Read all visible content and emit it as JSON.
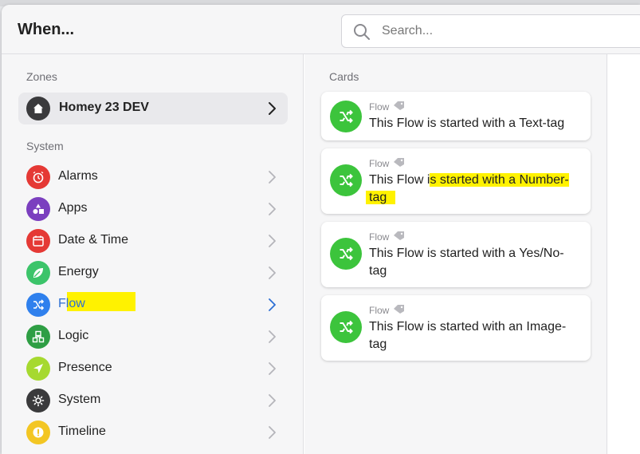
{
  "dialog": {
    "title": "When...",
    "search_placeholder": "Search..."
  },
  "zones": {
    "label": "Zones",
    "item": {
      "label": "Homey 23 DEV",
      "icon": "home-icon"
    }
  },
  "system": {
    "label": "System",
    "items": [
      {
        "label": "Alarms",
        "icon": "alarm-clock-icon",
        "color": "#e53935"
      },
      {
        "label": "Apps",
        "icon": "apps-icon",
        "color": "#7b3fbf"
      },
      {
        "label": "Date & Time",
        "icon": "calendar-icon",
        "color": "#e53935"
      },
      {
        "label": "Energy",
        "icon": "leaf-icon",
        "color": "#3cc46a"
      },
      {
        "label": "Flow",
        "icon": "shuffle-icon",
        "color": "#2f80ed",
        "selected": true
      },
      {
        "label": "Logic",
        "icon": "logic-icon",
        "color": "#2e9e44"
      },
      {
        "label": "Presence",
        "icon": "location-arrow-icon",
        "color": "#a6d930"
      },
      {
        "label": "System",
        "icon": "gear-icon",
        "color": "#3a3a3c"
      },
      {
        "label": "Timeline",
        "icon": "exclamation-icon",
        "color": "#f3c623"
      }
    ]
  },
  "cards": {
    "label": "Cards",
    "items": [
      {
        "app": "Flow",
        "title_line1": "This Flow is started with a Text-tag",
        "title_line2": ""
      },
      {
        "app": "Flow",
        "title_pre": "This Flow i",
        "title_hl1": "s started with a Number-",
        "title_hl2": "tag"
      },
      {
        "app": "Flow",
        "title_line1": "This Flow is started with a Yes/No-",
        "title_line2": "tag"
      },
      {
        "app": "Flow",
        "title_line1": "This Flow is started with an Image-",
        "title_line2": "tag"
      }
    ]
  }
}
